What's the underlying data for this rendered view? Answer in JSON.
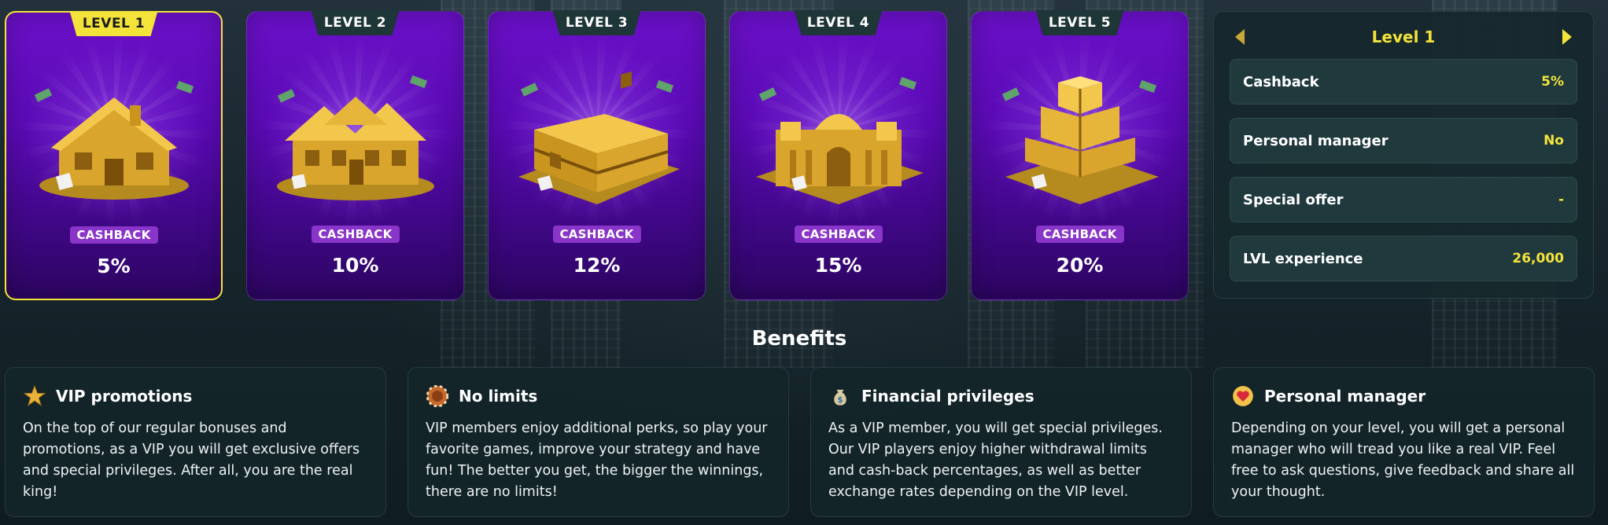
{
  "levels": [
    {
      "label": "LEVEL 1",
      "cashback_label": "CASHBACK",
      "cashback": "5%",
      "active": true
    },
    {
      "label": "LEVEL 2",
      "cashback_label": "CASHBACK",
      "cashback": "10%"
    },
    {
      "label": "LEVEL 3",
      "cashback_label": "CASHBACK",
      "cashback": "12%"
    },
    {
      "label": "LEVEL 4",
      "cashback_label": "CASHBACK",
      "cashback": "15%"
    },
    {
      "label": "LEVEL 5",
      "cashback_label": "CASHBACK",
      "cashback": "20%"
    }
  ],
  "panel": {
    "title": "Level 1",
    "rows": [
      {
        "label": "Cashback",
        "value": "5%"
      },
      {
        "label": "Personal manager",
        "value": "No"
      },
      {
        "label": "Special offer",
        "value": "-"
      },
      {
        "label": "LVL experience",
        "value": "26,000"
      }
    ]
  },
  "benefits": {
    "title": "Benefits",
    "items": [
      {
        "icon": "star-icon",
        "title": "VIP promotions",
        "text": "On the top of our regular bonuses and promotions, as a VIP you will get exclusive offers and special privileges. After all, you are the real king!"
      },
      {
        "icon": "chip-icon",
        "title": "No limits",
        "text": "VIP members enjoy additional perks, so play your favorite games, improve your strategy and have fun! The better you get, the bigger the winnings, there are no limits!"
      },
      {
        "icon": "money-bag-icon",
        "title": "Financial privileges",
        "text": "As a VIP member, you will get special privileges. Our VIP players enjoy higher withdrawal limits and cash-back percentages, as well as better exchange rates depending on the VIP level."
      },
      {
        "icon": "heart-icon",
        "title": "Personal manager",
        "text": "Depending on your level, you will get a personal manager who will tread you like a real VIP. Feel free to ask questions, give feedback and share all your thought."
      }
    ]
  },
  "colors": {
    "accent": "#f4e43a",
    "card_purple": "#5a0ab4",
    "panel_bg": "#16282c",
    "badge": "#8a35c9"
  }
}
